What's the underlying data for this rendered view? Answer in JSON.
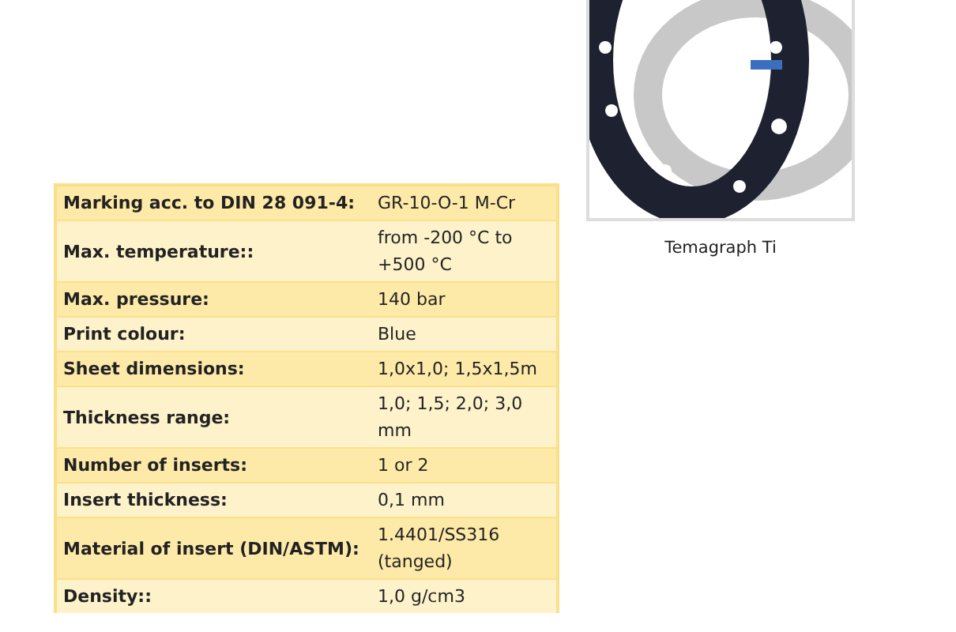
{
  "spec_table": {
    "rows": [
      {
        "label": "Marking acc. to DIN 28 091-4:",
        "value": "GR-10-O-1 M-Cr"
      },
      {
        "label": "Max. temperature::",
        "value": "from -200 °C to +500 °C"
      },
      {
        "label": "Max. pressure:",
        "value": "140 bar"
      },
      {
        "label": "Print colour:",
        "value": "Blue"
      },
      {
        "label": "Sheet dimensions:",
        "value": "1,0x1,0; 1,5x1,5m"
      },
      {
        "label": "Thickness range:",
        "value": "1,0; 1,5; 2,0; 3,0 mm"
      },
      {
        "label": "Number of inserts:",
        "value": "1 or 2"
      },
      {
        "label": "Insert thickness:",
        "value": "0,1 mm"
      },
      {
        "label": "Material of insert (DIN/ASTM):",
        "value": "1.4401/SS316 (tanged)"
      },
      {
        "label": "Density::",
        "value": "1,0 g/cm3"
      }
    ]
  },
  "product_image": {
    "caption": "Temagraph Ti"
  }
}
